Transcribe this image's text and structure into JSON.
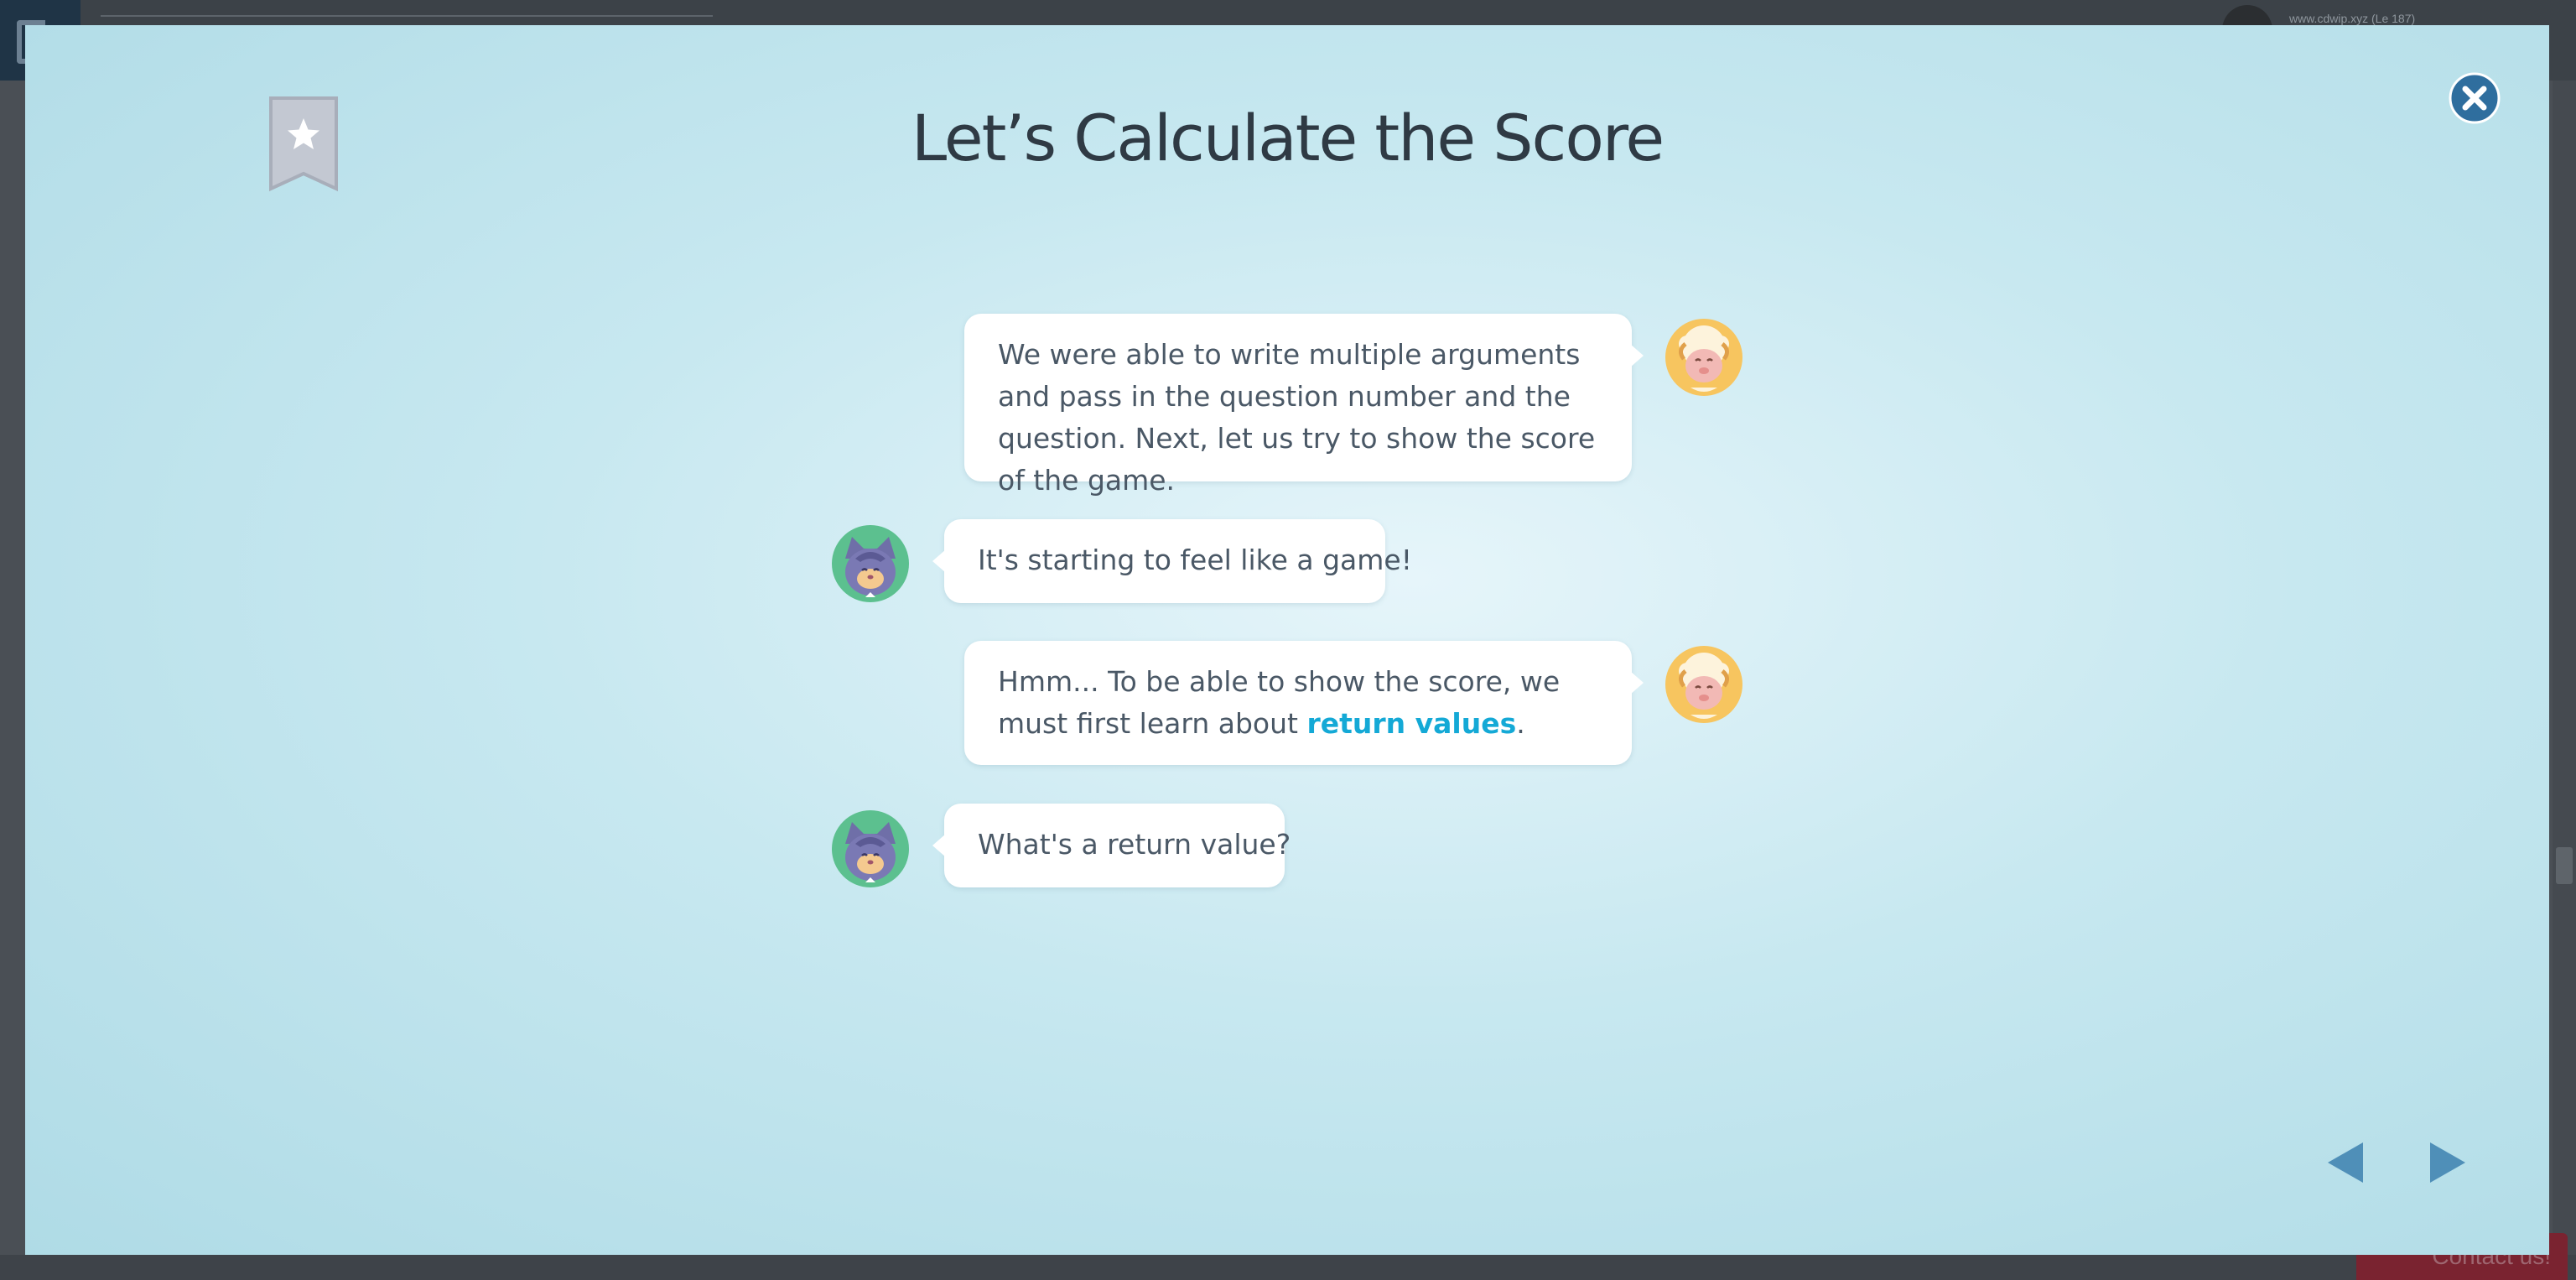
{
  "background": {
    "user_text": "www.cdwip.xyz (Le 187)",
    "contact_label": "Contact us!"
  },
  "modal": {
    "title": "Let’s Calculate the Score",
    "colors": {
      "title": "#2f3a44",
      "bubble_text": "#4a5866",
      "highlight": "#14a9d6",
      "close_button": "#2f6e9e",
      "nav_arrow": "#4f8fb8"
    },
    "messages": [
      {
        "speaker": "sheep",
        "side": "right",
        "text": "We were able to write multiple arguments and pass in the question number and the question. Next, let us try to show the score of the game."
      },
      {
        "speaker": "cat",
        "side": "left",
        "text": "It's starting to feel like a game!"
      },
      {
        "speaker": "sheep",
        "side": "right",
        "text_before": "Hmm... To be able to show the score, we must first learn about ",
        "highlight": "return values",
        "text_after": "."
      },
      {
        "speaker": "cat",
        "side": "left",
        "text": "What's a return value?"
      }
    ]
  }
}
